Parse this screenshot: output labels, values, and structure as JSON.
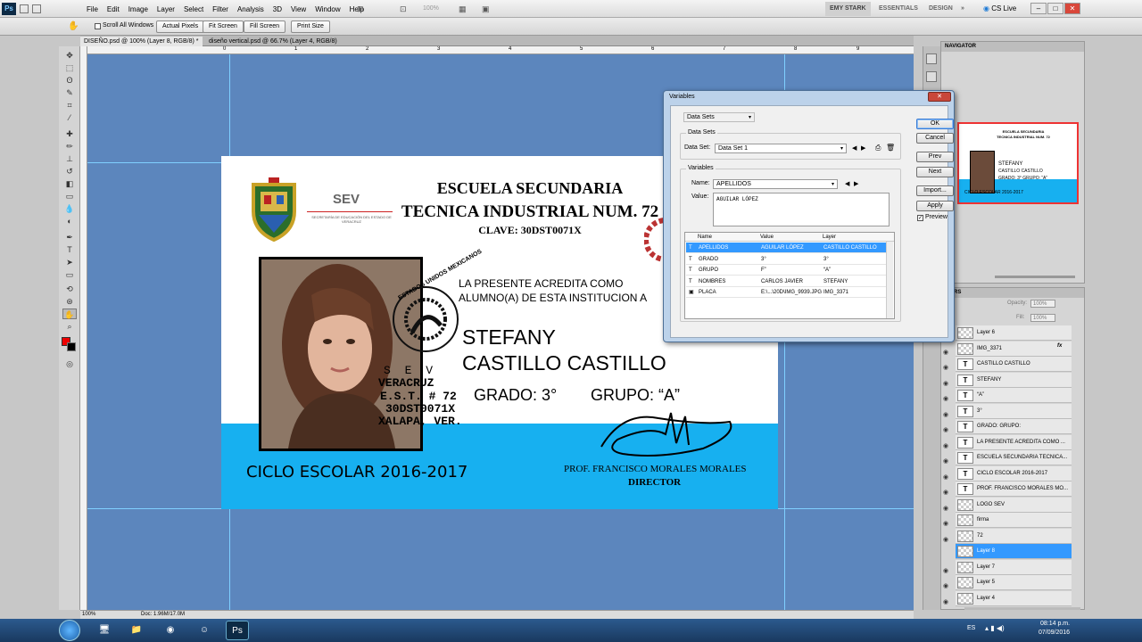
{
  "app": {
    "logo": "Ps",
    "menu": [
      "File",
      "Edit",
      "Image",
      "Layer",
      "Select",
      "Filter",
      "Analysis",
      "3D",
      "View",
      "Window",
      "Help"
    ],
    "zoom_display": "100%",
    "workspaces": [
      "EMY STARK",
      "ESSENTIALS",
      "DESIGN"
    ],
    "more": "»",
    "cs_live": "CS Live",
    "win_min": "–",
    "win_max": "□",
    "win_close": "✕"
  },
  "options": {
    "scroll_all": "Scroll All Windows",
    "actual_pixels": "Actual Pixels",
    "fit_screen": "Fit Screen",
    "fill_screen": "Fill Screen",
    "print_size": "Print Size"
  },
  "tabs": [
    {
      "label": "DISEÑO.psd @ 100% (Layer 8, RGB/8) *"
    },
    {
      "label": "diseño vertical.psd @ 66.7% (Layer 4, RGB/8)"
    }
  ],
  "ruler": [
    "0",
    "1",
    "2",
    "3",
    "4",
    "5",
    "6",
    "7",
    "8",
    "9",
    "10"
  ],
  "card": {
    "sev": "SEV",
    "sev_sub": "SECRETARÍA DE EDUCACIÓN DEL ESTADO DE VERACRUZ",
    "school1": "ESCUELA SECUNDARIA",
    "school2": "TECNICA INDUSTRIAL NUM. 72",
    "clave": "CLAVE: 30DST0071X",
    "acredita1": "LA PRESENTE ACREDITA COMO",
    "acredita2": "ALUMNO(A) DE ESTA INSTITUCION A",
    "seal_text": "ESTADOS UNIDOS MEXICANOS",
    "stamp1": "S E V",
    "stamp2": "VERACRUZ",
    "stamp3": "E.S.T. # 72",
    "stamp4": "30DST0071X",
    "stamp5": "XALAPA, VER.",
    "nombre": "STEFANY",
    "apellidos": "CASTILLO CASTILLO",
    "grado": "GRADO: 3°",
    "grupo": "GRUPO: “A”",
    "ciclo": "CICLO ESCOLAR  2016-2017",
    "prof": "PROF. FRANCISCO MORALES MORALES",
    "director": "DIRECTOR"
  },
  "dialog": {
    "title": "Variables",
    "close": "✕",
    "section_select": "Data Sets",
    "data_sets_group": "Data Sets",
    "data_set_label": "Data Set:",
    "data_set_value": "Data Set 1",
    "variables_group": "Variables",
    "name_label": "Name:",
    "name_value": "APELLIDOS",
    "value_label": "Value:",
    "value_value": "AGUILAR LÓPEZ",
    "columns": [
      "Name",
      "Value",
      "Layer"
    ],
    "rows": [
      {
        "icon": "T",
        "name": "APELLIDOS",
        "value": "AGUILAR LÓPEZ",
        "layer": "CASTILLO CASTILLO",
        "selected": true
      },
      {
        "icon": "T",
        "name": "GRADO",
        "value": "3°",
        "layer": "3°",
        "selected": false
      },
      {
        "icon": "T",
        "name": "GRUPO",
        "value": "F”",
        "layer": "“A”",
        "selected": false
      },
      {
        "icon": "T",
        "name": "NOMBRES",
        "value": "CARLOS JAVIER",
        "layer": "STEFANY",
        "selected": false
      },
      {
        "icon": "▣",
        "name": "PLACA",
        "value": "E:\\...\\20D\\IMG_9939.JPG",
        "layer": "IMG_3371",
        "selected": false
      }
    ],
    "ok": "OK",
    "cancel": "Cancel",
    "prev": "Prev",
    "next": "Next",
    "import": "Import...",
    "apply": "Apply",
    "preview": "Preview"
  },
  "navigator": {
    "title": "NAVIGATOR",
    "mini_school1": "ESCUELA SECUNDARIA",
    "mini_school2": "TECNICA INDUSTRIAL NUM. 72",
    "mini_name": "STEFANY",
    "mini_last": "CASTILLO CASTILLO",
    "mini_grado": "GRADO: 3°   GRUPO: “A”",
    "mini_ciclo": "CICLO ESCOLAR  2016-2017"
  },
  "layers": {
    "title": "RS",
    "opacity_label": "Opacity:",
    "opacity": "100%",
    "fill_label": "Fill:",
    "fill": "100%",
    "fx": "fx",
    "items": [
      {
        "thumb": "img",
        "name": "Layer 6",
        "selected": false
      },
      {
        "thumb": "img",
        "name": "IMG_3371",
        "selected": false
      },
      {
        "thumb": "T",
        "name": "CASTILLO CASTILLO",
        "selected": false
      },
      {
        "thumb": "T",
        "name": "STEFANY",
        "selected": false
      },
      {
        "thumb": "T",
        "name": "“A”",
        "selected": false
      },
      {
        "thumb": "T",
        "name": "3°",
        "selected": false
      },
      {
        "thumb": "T",
        "name": "GRADO:      GRUPO:",
        "selected": false
      },
      {
        "thumb": "T",
        "name": "LA PRESENTE ACREDITA COMO ...",
        "selected": false
      },
      {
        "thumb": "T",
        "name": "ESCUELA SECUNDARIA TECNICA...",
        "selected": false
      },
      {
        "thumb": "T",
        "name": "CICLO ESCOLAR  2016-2017",
        "selected": false
      },
      {
        "thumb": "T",
        "name": "PROF. FRANCISCO MORALES MO...",
        "selected": false
      },
      {
        "thumb": "img",
        "name": "LOGO SEV",
        "selected": false
      },
      {
        "thumb": "img",
        "name": "firma",
        "selected": false
      },
      {
        "thumb": "img",
        "name": "72",
        "selected": false
      },
      {
        "thumb": "img",
        "name": "Layer 8",
        "selected": true
      },
      {
        "thumb": "img",
        "name": "Layer 7",
        "selected": false
      },
      {
        "thumb": "img",
        "name": "Layer 5",
        "selected": false
      },
      {
        "thumb": "img",
        "name": "Layer 4",
        "selected": false
      }
    ]
  },
  "status": {
    "zoom": "100%",
    "doc": "Doc: 1.96M/17.0M"
  },
  "taskbar": {
    "lang": "ES",
    "time": "08:14 p.m.",
    "date": "07/09/2016"
  }
}
